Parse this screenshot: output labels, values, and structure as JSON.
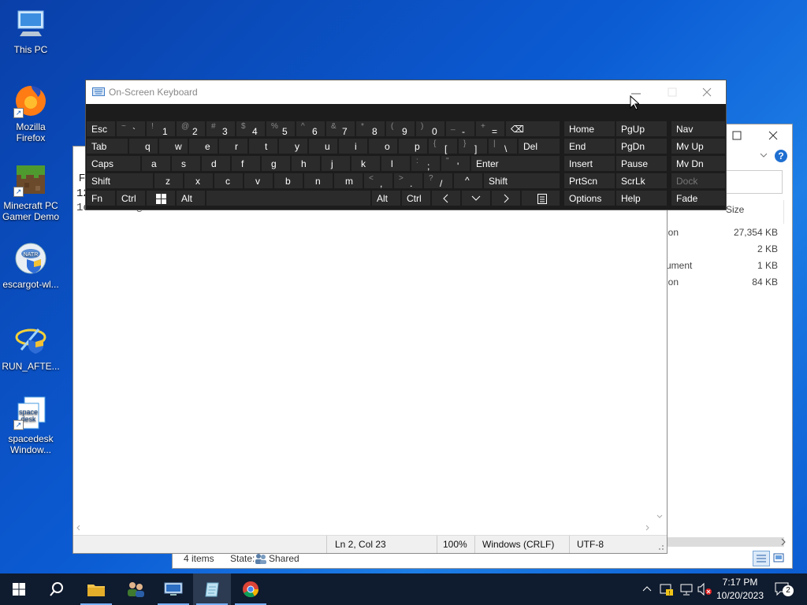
{
  "desktop": {
    "icons": [
      {
        "label": "This PC"
      },
      {
        "label": "Mozilla\nFirefox"
      },
      {
        "label": "Minecraft PC\nGamer Demo"
      },
      {
        "label": "escargot-wl..."
      },
      {
        "label": "RUN_AFTE..."
      },
      {
        "label": "spacedesk\nWindow..."
      }
    ]
  },
  "explorer": {
    "column_size": "Size",
    "rows": [
      {
        "type": "ion",
        "size": "27,354 KB"
      },
      {
        "type": "",
        "size": "2 KB"
      },
      {
        "type": "ument",
        "size": "1 KB"
      },
      {
        "type": "ion",
        "size": "84 KB"
      }
    ],
    "status_items": "4 items",
    "status_state_label": "State:",
    "status_state_value": "Shared"
  },
  "notepad": {
    "menu_fragment": "F",
    "line1": "12",
    "line2": "1e71c0906@dcddd2m.com",
    "status": {
      "position": "Ln 2, Col 23",
      "zoom": "100%",
      "eol": "Windows (CRLF)",
      "encoding": "UTF-8"
    }
  },
  "osk": {
    "title": "On-Screen Keyboard",
    "rows": [
      [
        {
          "label": "Esc"
        },
        {
          "shift": "~",
          "lo": "`"
        },
        {
          "shift": "!",
          "lo": "1"
        },
        {
          "shift": "@",
          "lo": "2"
        },
        {
          "shift": "#",
          "lo": "3"
        },
        {
          "shift": "$",
          "lo": "4"
        },
        {
          "shift": "%",
          "lo": "5"
        },
        {
          "shift": "^",
          "lo": "6"
        },
        {
          "shift": "&",
          "lo": "7"
        },
        {
          "shift": "*",
          "lo": "8"
        },
        {
          "shift": "(",
          "lo": "9"
        },
        {
          "shift": ")",
          "lo": "0"
        },
        {
          "shift": "_",
          "lo": "-"
        },
        {
          "shift": "+",
          "lo": "="
        },
        {
          "label": "⌫"
        }
      ],
      [
        {
          "label": "Tab"
        },
        {
          "label": "q"
        },
        {
          "label": "w"
        },
        {
          "label": "e"
        },
        {
          "label": "r"
        },
        {
          "label": "t"
        },
        {
          "label": "y"
        },
        {
          "label": "u"
        },
        {
          "label": "i"
        },
        {
          "label": "o"
        },
        {
          "label": "p"
        },
        {
          "shift": "{",
          "lo": "["
        },
        {
          "shift": "}",
          "lo": "]"
        },
        {
          "shift": "|",
          "lo": "\\"
        },
        {
          "label": "Del"
        }
      ],
      [
        {
          "label": "Caps"
        },
        {
          "label": "a"
        },
        {
          "label": "s"
        },
        {
          "label": "d"
        },
        {
          "label": "f"
        },
        {
          "label": "g"
        },
        {
          "label": "h"
        },
        {
          "label": "j"
        },
        {
          "label": "k"
        },
        {
          "label": "l"
        },
        {
          "shift": ":",
          "lo": ";"
        },
        {
          "shift": "\"",
          "lo": "'"
        },
        {
          "label": "Enter"
        }
      ],
      [
        {
          "label": "Shift"
        },
        {
          "label": "z"
        },
        {
          "label": "x"
        },
        {
          "label": "c"
        },
        {
          "label": "v"
        },
        {
          "label": "b"
        },
        {
          "label": "n"
        },
        {
          "label": "m"
        },
        {
          "shift": "<",
          "lo": ","
        },
        {
          "shift": ">",
          "lo": "."
        },
        {
          "shift": "?",
          "lo": "/"
        },
        {
          "label": "^"
        },
        {
          "label": "Shift"
        }
      ],
      [
        {
          "label": "Fn"
        },
        {
          "label": "Ctrl"
        },
        {
          "label": "win"
        },
        {
          "label": "Alt"
        },
        {
          "label": ""
        },
        {
          "label": "Alt"
        },
        {
          "label": "Ctrl"
        },
        {
          "label": "<"
        },
        {
          "label": "v"
        },
        {
          "label": ">"
        },
        {
          "label": "menu"
        }
      ]
    ],
    "side_keys": [
      [
        "Home",
        "PgUp",
        "Nav"
      ],
      [
        "End",
        "PgDn",
        "Mv Up"
      ],
      [
        "Insert",
        "Pause",
        "Mv Dn"
      ],
      [
        "PrtScn",
        "ScrLk",
        "Dock"
      ],
      [
        "Options",
        "Help",
        "Fade"
      ]
    ]
  },
  "taskbar": {
    "time": "7:17 PM",
    "date": "10/20/2023",
    "notification_count": "2"
  },
  "colors": {
    "desktop_blue": "#0b5bd3",
    "osk_bg": "#1c1c1c",
    "osk_key": "#2b2b2b",
    "taskbar": "#0f1b2e",
    "accent": "#79b2ff"
  }
}
